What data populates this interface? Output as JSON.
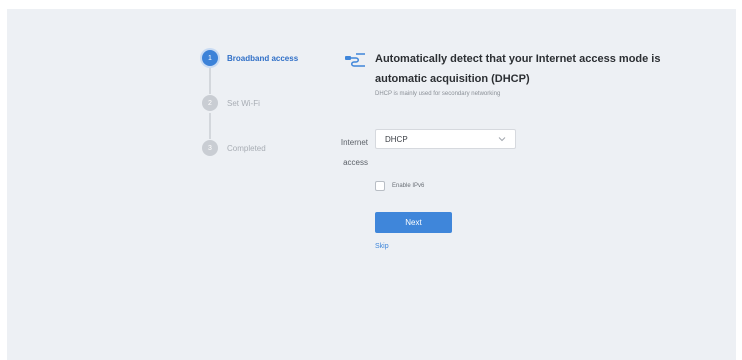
{
  "stepper": {
    "steps": [
      {
        "number": "1",
        "label": "Broadband access",
        "state": "active"
      },
      {
        "number": "2",
        "label": "Set Wi-Fi",
        "state": "inactive"
      },
      {
        "number": "3",
        "label": "Completed",
        "state": "inactive"
      }
    ]
  },
  "main": {
    "icon": "router-icon",
    "title": "Automatically detect that your Internet access mode is automatic acquisition (DHCP)",
    "subtitle": "DHCP is mainly used for secondary networking",
    "internet_access": {
      "label_line1": "Internet",
      "label_line2": "access",
      "selected": "DHCP",
      "dropdown_icon": "chevron-down-icon"
    },
    "ipv6": {
      "label": "Enable IPv6",
      "checked": false
    },
    "next_label": "Next",
    "skip_label": "Skip"
  },
  "colors": {
    "accent": "#3f86da",
    "panel_background": "#edf0f4",
    "inactive_step": "#c9cdd3"
  }
}
